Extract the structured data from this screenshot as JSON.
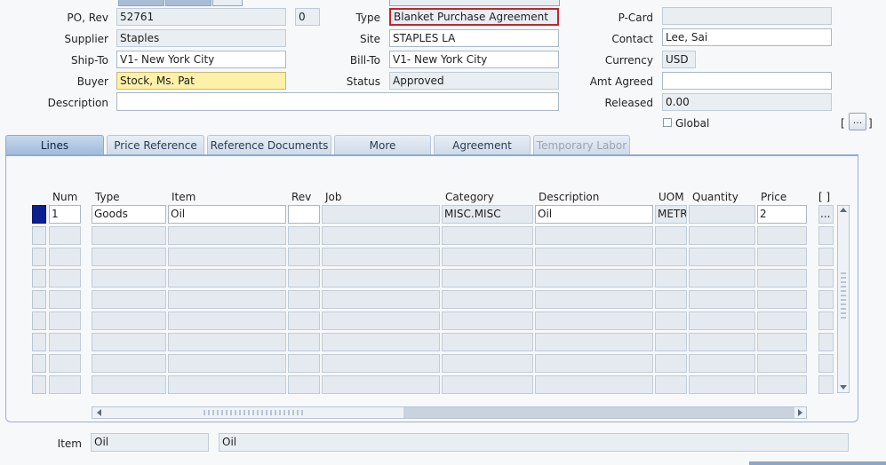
{
  "header": {
    "po_rev_label": "PO, Rev",
    "po_number": "52761",
    "revision": "0",
    "type_label": "Type",
    "type_value": "Blanket Purchase Agreement",
    "pcard_label": "P-Card",
    "pcard_value": "",
    "supplier_label": "Supplier",
    "supplier_value": "Staples",
    "site_label": "Site",
    "site_value": "STAPLES LA",
    "contact_label": "Contact",
    "contact_value": "Lee, Sai",
    "shipto_label": "Ship-To",
    "shipto_value": "V1- New York City",
    "billto_label": "Bill-To",
    "billto_value": "V1- New York City",
    "currency_label": "Currency",
    "currency_value": "USD",
    "buyer_label": "Buyer",
    "buyer_value": "Stock, Ms. Pat",
    "status_label": "Status",
    "status_value": "Approved",
    "amt_agreed_label": "Amt Agreed",
    "amt_agreed_value": "",
    "description_label": "Description",
    "description_value": "",
    "released_label": "Released",
    "released_value": "0.00",
    "global_label": "Global",
    "bracket_open": "[",
    "bracket_close": "]",
    "ellipsis": "...",
    "highlight_color": "#c0262c"
  },
  "tabs": [
    {
      "label": "Lines",
      "state": "active"
    },
    {
      "label": "Price Reference",
      "state": "normal"
    },
    {
      "label": "Reference Documents",
      "state": "normal"
    },
    {
      "label": "More",
      "state": "normal"
    },
    {
      "label": "Agreement",
      "state": "normal"
    },
    {
      "label": "Temporary Labor",
      "state": "disabled"
    }
  ],
  "lines": {
    "columns": [
      "Num",
      "Type",
      "Item",
      "Rev",
      "Job",
      "Category",
      "Description",
      "UOM",
      "Quantity",
      "Price",
      "[ ]"
    ],
    "rows": [
      {
        "num": "1",
        "type": "Goods",
        "item": "Oil",
        "rev": "",
        "job": "",
        "category": "MISC.MISC",
        "description": "Oil",
        "uom": "METR",
        "quantity": "",
        "price": "2",
        "more": "..."
      }
    ],
    "empty_rows": 8
  },
  "footer": {
    "item_label": "Item",
    "item_value": "Oil",
    "item_description": "Oil"
  }
}
